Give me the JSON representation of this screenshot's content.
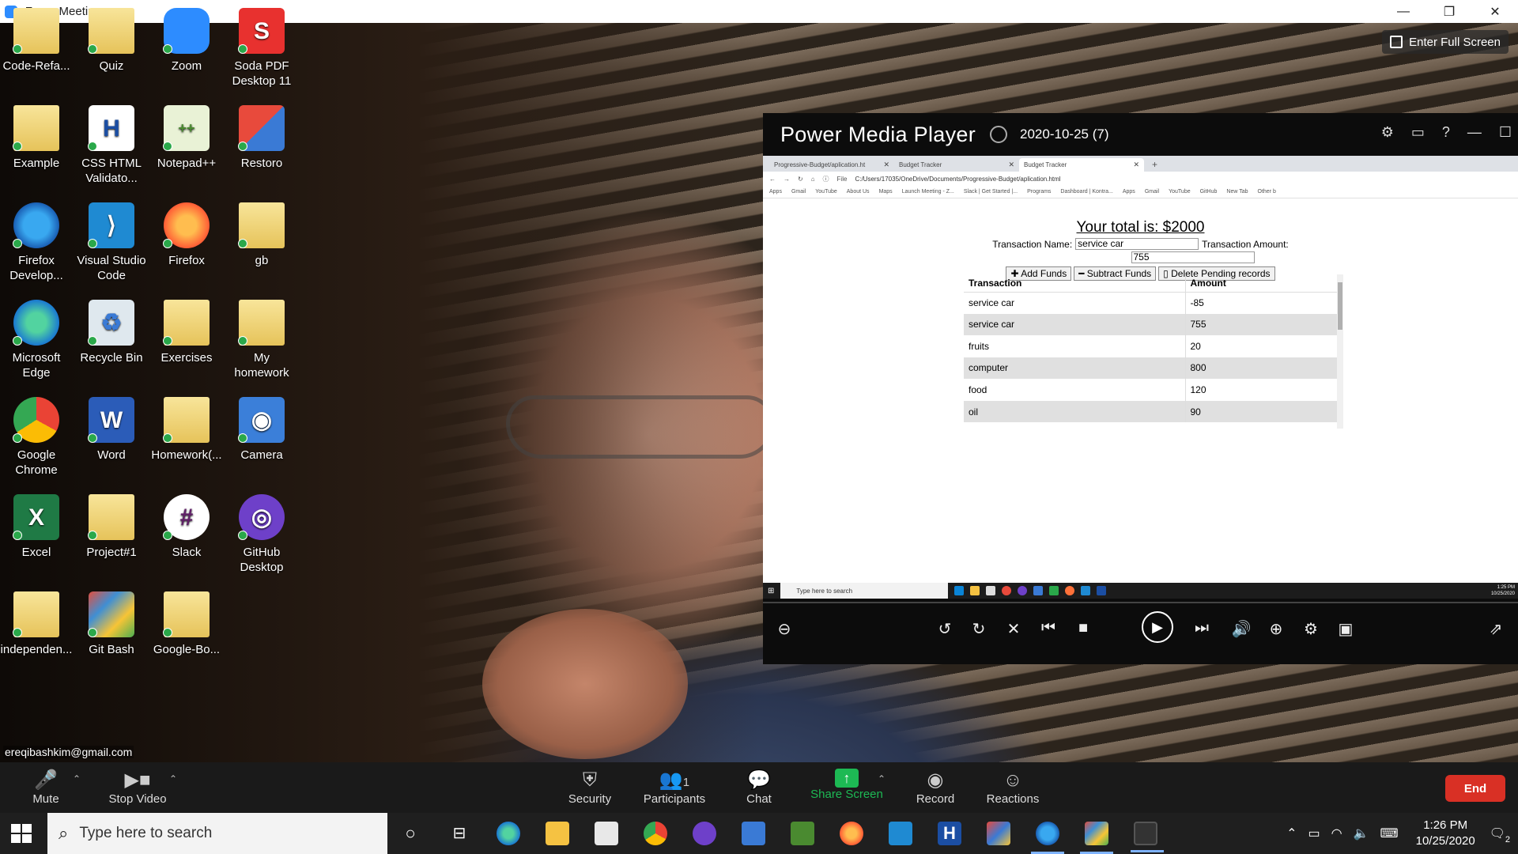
{
  "zoom": {
    "window_title": "Zoom Meeting",
    "enter_full_screen": "Enter Full Screen",
    "participant_email": "ereqibashkim@gmail.com",
    "toolbar": {
      "mute": "Mute",
      "stop_video": "Stop Video",
      "security": "Security",
      "participants": "Participants",
      "participants_count": "1",
      "chat": "Chat",
      "share_screen": "Share Screen",
      "record": "Record",
      "reactions": "Reactions",
      "end": "End"
    }
  },
  "desktop_icons": [
    {
      "label": "Code-Refa...",
      "icon": "folder"
    },
    {
      "label": "Quiz",
      "icon": "folder"
    },
    {
      "label": "Zoom",
      "icon": "zoom-icon"
    },
    {
      "label": "Soda PDF Desktop 11",
      "icon": "soda-pdf-icon",
      "glyph": "S"
    },
    {
      "label": "Example",
      "icon": "folder"
    },
    {
      "label": "CSS HTML Validato...",
      "icon": "html-validator-icon",
      "glyph": "H"
    },
    {
      "label": "Notepad++",
      "icon": "notepad-plus-plus-icon",
      "glyph": "++"
    },
    {
      "label": "Restoro",
      "icon": "restoro-icon"
    },
    {
      "label": "Firefox Develop...",
      "icon": "firefox-developer-icon"
    },
    {
      "label": "Visual Studio Code",
      "icon": "vscode-icon",
      "glyph": "⟩"
    },
    {
      "label": "Firefox",
      "icon": "firefox-icon"
    },
    {
      "label": "gb",
      "icon": "folder"
    },
    {
      "label": "Microsoft Edge",
      "icon": "edge-icon"
    },
    {
      "label": "Recycle Bin",
      "icon": "recycle-bin-icon",
      "glyph": "♻"
    },
    {
      "label": "Exercises",
      "icon": "folder"
    },
    {
      "label": "My homework",
      "icon": "folder"
    },
    {
      "label": "Google Chrome",
      "icon": "chrome-icon"
    },
    {
      "label": "Word",
      "icon": "word-icon",
      "glyph": "W"
    },
    {
      "label": "Homework(...",
      "icon": "folder"
    },
    {
      "label": "Camera",
      "icon": "camera-icon",
      "glyph": "◉"
    },
    {
      "label": "Excel",
      "icon": "excel-icon",
      "glyph": "X"
    },
    {
      "label": "Project#1",
      "icon": "folder"
    },
    {
      "label": "Slack",
      "icon": "slack-icon",
      "glyph": "#"
    },
    {
      "label": "GitHub Desktop",
      "icon": "github-icon",
      "glyph": "◎"
    },
    {
      "label": "independen...",
      "icon": "folder"
    },
    {
      "label": "Git Bash",
      "icon": "git-bash-icon"
    },
    {
      "label": "Google-Bo...",
      "icon": "folder"
    }
  ],
  "media_player": {
    "app_name": "Power Media Player",
    "file_name": "2020-10-25 (7)"
  },
  "browser": {
    "tabs": [
      {
        "label": "Progressive-Budget/aplication.ht"
      },
      {
        "label": "Budget Tracker"
      },
      {
        "label": "Budget Tracker"
      }
    ],
    "address_prefix": "File",
    "address": "C:/Users/17035/OneDrive/Documents/Progressive-Budget/aplication.html",
    "bookmarks": [
      "Apps",
      "Gmail",
      "YouTube",
      "About Us",
      "Maps",
      "Launch Meeting - Z...",
      "Slack | Get Started |...",
      "Programs",
      "Dashboard | Kontra...",
      "Apps",
      "Gmail",
      "YouTube",
      "GitHub",
      "New Tab",
      "Other b"
    ]
  },
  "budget": {
    "total": "Your total is: $2000",
    "transaction_name_label": "Transaction Name:",
    "transaction_name_value": "service car",
    "transaction_amount_label": "Transaction Amount:",
    "transaction_amount_value": "755",
    "add_funds": "Add Funds",
    "subtract_funds": "Subtract Funds",
    "delete_pending": "Delete Pending records",
    "table_headers": [
      "Transaction",
      "Amount"
    ],
    "rows": [
      {
        "name": "service car",
        "amount": "-85"
      },
      {
        "name": "service car",
        "amount": "755"
      },
      {
        "name": "fruits",
        "amount": "20"
      },
      {
        "name": "computer",
        "amount": "800"
      },
      {
        "name": "food",
        "amount": "120"
      },
      {
        "name": "oil",
        "amount": "90"
      }
    ]
  },
  "inner_taskbar": {
    "search_placeholder": "Type here to search",
    "time": "1:25 PM",
    "date": "10/25/2020"
  },
  "taskbar": {
    "search_placeholder": "Type here to search",
    "time": "1:26 PM",
    "date": "10/25/2020",
    "notification_count": "2"
  }
}
